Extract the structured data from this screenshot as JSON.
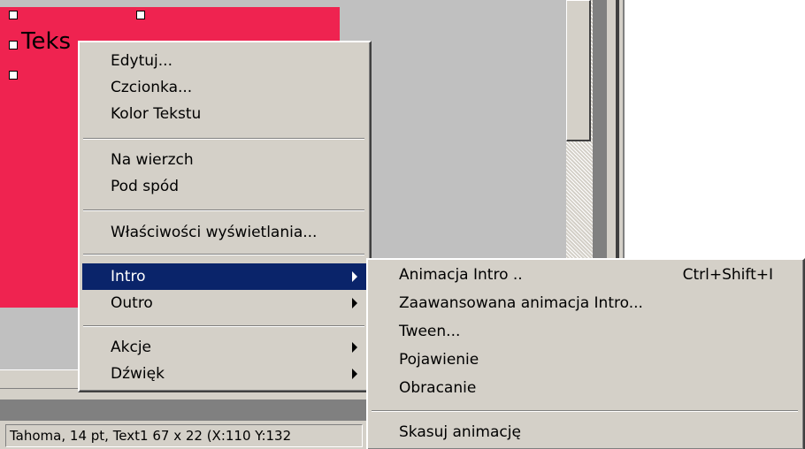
{
  "canvas": {
    "element_text": "Teks",
    "element_color": "#ef2350"
  },
  "status": {
    "text": "Tahoma, 14 pt, Text1 67 x 22 (X:110 Y:132"
  },
  "context_menu": {
    "items": [
      {
        "label": "Edytuj..."
      },
      {
        "label": "Czcionka..."
      },
      {
        "label": "Kolor Tekstu"
      },
      {
        "label": "Na wierzch"
      },
      {
        "label": "Pod spód"
      },
      {
        "label": "Właściwości wyświetlania..."
      },
      {
        "label": "Intro",
        "submenu": true,
        "selected": true
      },
      {
        "label": "Outro",
        "submenu": true
      },
      {
        "label": "Akcje",
        "submenu": true
      },
      {
        "label": "Dźwięk",
        "submenu": true
      }
    ]
  },
  "intro_submenu": {
    "items": [
      {
        "label": "Animacja Intro ..",
        "shortcut": "Ctrl+Shift+I"
      },
      {
        "label": "Zaawansowana animacja Intro..."
      },
      {
        "label": "Tween..."
      },
      {
        "label": "Pojawienie"
      },
      {
        "label": "Obracanie"
      },
      {
        "label": "Skasuj animację"
      }
    ]
  },
  "colors": {
    "menu_bg": "#d4d0c8",
    "highlight": "#0a246a",
    "canvas_bg": "#c0c0c0"
  }
}
